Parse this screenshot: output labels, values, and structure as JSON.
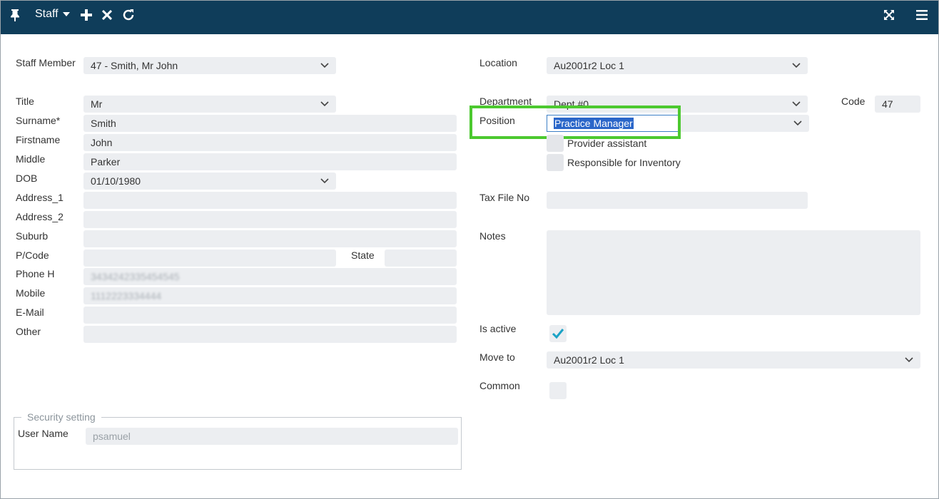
{
  "toolbar": {
    "title": "Staff",
    "icons": [
      "pin-icon",
      "chevron-down-icon",
      "plus-icon",
      "close-icon",
      "refresh-icon",
      "expand-icon",
      "menu-icon"
    ]
  },
  "left": {
    "staff_member": {
      "label": "Staff Member",
      "value": "47 - Smith, Mr John"
    },
    "title": {
      "label": "Title",
      "value": "Mr"
    },
    "surname": {
      "label": "Surname*",
      "value": "Smith"
    },
    "firstname": {
      "label": "Firstname",
      "value": "John"
    },
    "middle": {
      "label": "Middle",
      "value": "Parker"
    },
    "dob": {
      "label": "DOB",
      "value": "01/10/1980"
    },
    "address1": {
      "label": "Address_1",
      "value": ""
    },
    "address2": {
      "label": "Address_2",
      "value": ""
    },
    "suburb": {
      "label": "Suburb",
      "value": ""
    },
    "pcode": {
      "label": "P/Code",
      "value": ""
    },
    "state": {
      "label": "State",
      "value": ""
    },
    "phone_h": {
      "label": "Phone H",
      "value": "3434242335454545"
    },
    "mobile": {
      "label": "Mobile",
      "value": "1112223334444"
    },
    "email": {
      "label": "E-Mail",
      "value": ""
    },
    "other": {
      "label": "Other",
      "value": ""
    }
  },
  "right": {
    "location": {
      "label": "Location",
      "value": "Au2001r2 Loc 1"
    },
    "department": {
      "label": "Department",
      "value": "Dept #0"
    },
    "code": {
      "label": "Code",
      "value": "47"
    },
    "position": {
      "label": "Position",
      "value": "Practice Manager"
    },
    "provider_assistant": {
      "label": "Provider assistant",
      "checked": false
    },
    "responsible_inventory": {
      "label": "Responsible for Inventory",
      "checked": false
    },
    "tax_file": {
      "label": "Tax File No",
      "value": ""
    },
    "notes": {
      "label": "Notes",
      "value": ""
    },
    "is_active": {
      "label": "Is active",
      "checked": true
    },
    "move_to": {
      "label": "Move to",
      "value": "Au2001r2 Loc 1"
    },
    "common": {
      "label": "Common",
      "checked": false
    }
  },
  "security": {
    "legend": "Security setting",
    "user_name": {
      "label": "User Name",
      "value": "psamuel"
    }
  },
  "colors": {
    "topbar": "#0f3d5a",
    "highlight": "#4cc92f",
    "field_bg": "#eceef1",
    "check": "#1ba3c6"
  }
}
